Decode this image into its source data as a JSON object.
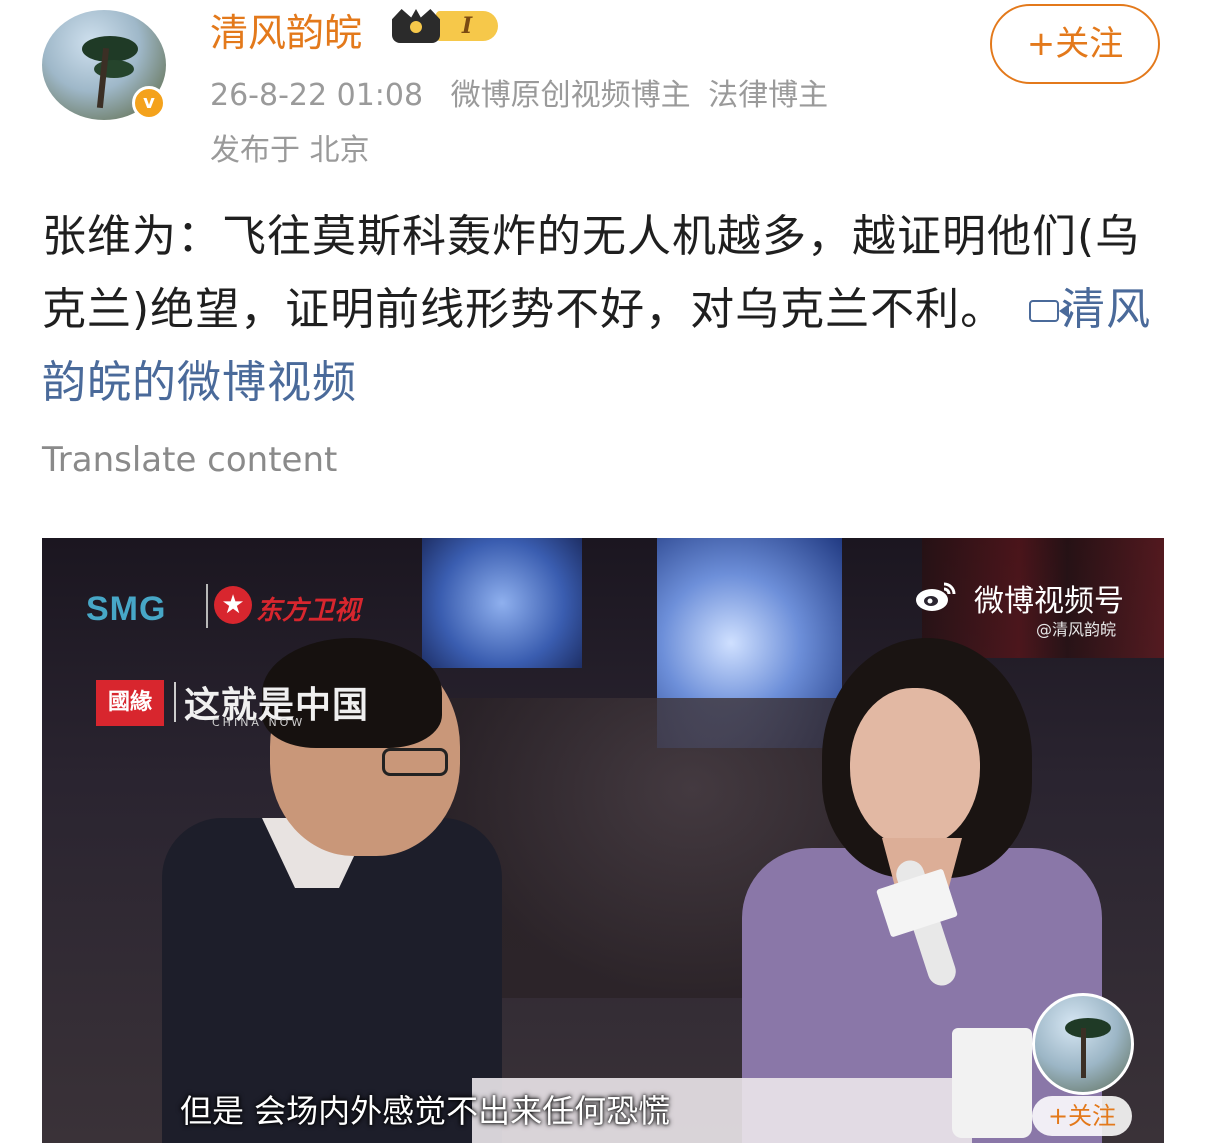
{
  "header": {
    "username": "清风韵皖",
    "level_label": "I",
    "timestamp": "26-8-22 01:08",
    "tags": [
      "微博原创视频博主",
      "法律博主"
    ],
    "location": "发布于 北京",
    "follow_label": "+关注",
    "verify_mark": "v"
  },
  "post": {
    "text": "张维为：飞往莫斯科轰炸的无人机越多，越证明他们(乌克兰)绝望，证明前线形势不好，对乌克兰不利。",
    "video_link_label": "清风韵皖的微博视频",
    "translate_label": "Translate content"
  },
  "video": {
    "broadcaster_logo": "SMG",
    "channel_logo_mark": "★",
    "channel_logo_text": "东方卫视",
    "partner_logo": "國緣",
    "show_title": "这就是中国",
    "show_subtitle": "CHINA NOW",
    "weibo_channel": "微博视频号",
    "weibo_handle": "@清风韵皖",
    "subtitle": "但是 会场内外感觉不出来任何恐慌",
    "overlay_follow_label": "+关注"
  },
  "colors": {
    "accent": "#e3791b",
    "link": "#4a6a9a",
    "meta_text": "#9a9a9a",
    "verify_badge": "#f4a21c"
  },
  "icons": [
    "verified-badge-icon",
    "crown-icon",
    "video-link-icon",
    "weibo-logo-icon"
  ]
}
